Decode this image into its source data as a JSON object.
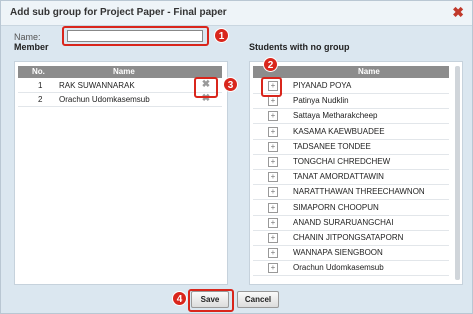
{
  "dialog": {
    "title": "Add sub group for Project Paper - Final paper",
    "close_icon": "close-x-icon"
  },
  "form": {
    "name_label": "Name:",
    "name_value": ""
  },
  "members": {
    "section_label": "Member",
    "columns": [
      "No.",
      "Name"
    ],
    "rows": [
      {
        "no": "1",
        "name": "RAK SUWANNARAK"
      },
      {
        "no": "2",
        "name": "Orachun Udomkasemsub"
      }
    ]
  },
  "students": {
    "section_label": "Students with no group",
    "columns": [
      "Name"
    ],
    "rows": [
      "PIYANAD POYA",
      "Patinya Nudklin",
      "Sattaya Metharakcheep",
      "KASAMA KAEWBUADEE",
      "TADSANEE TONDEE",
      "TONGCHAI CHREDCHEW",
      "TANAT AMORDATTAWIN",
      "NARATTHAWAN THREECHAWNON",
      "SIMAPORN CHOOPUN",
      "ANAND SURARUANGCHAI",
      "CHANIN JITPONGSATAPORN",
      "WANNAPA SIENGBOON",
      "Orachun Udomkasemsub"
    ]
  },
  "annotations": [
    "1",
    "2",
    "3",
    "4"
  ],
  "buttons": {
    "save": "Save",
    "cancel": "Cancel"
  },
  "colors": {
    "highlight": "#d9261c",
    "header_bg": "#8c8c8c",
    "dialog_bg": "#dbe7f0"
  }
}
